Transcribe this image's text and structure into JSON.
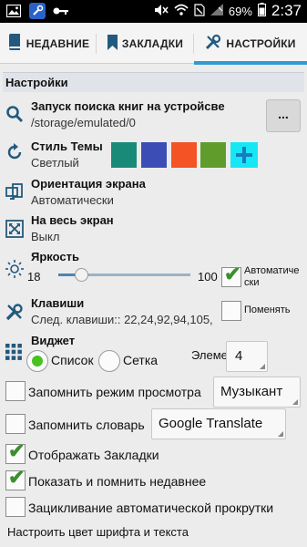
{
  "statusbar": {
    "icons_left": [
      "image-icon",
      "wrench-app-icon",
      "key-icon"
    ],
    "battery_percent": "69%",
    "time": "2:37"
  },
  "tabs": [
    {
      "label": "НЕДАВНИЕ",
      "icon": "book-icon",
      "active": false
    },
    {
      "label": "ЗАКЛАДКИ",
      "icon": "bookmark-icon",
      "active": false
    },
    {
      "label": "НАСТРОЙКИ",
      "icon": "tools-icon",
      "active": true
    }
  ],
  "settings": {
    "header": "Настройки",
    "search": {
      "title": "Запуск поиска книг на устройсве",
      "path": "/storage/emulated/0",
      "button": "..."
    },
    "theme": {
      "title": "Стиль Темы",
      "value": "Светлый",
      "colors": [
        "#1a8a78",
        "#3c4db5",
        "#f45326",
        "#5f9c2c"
      ],
      "add_label": "+",
      "add_color": "#16e7f4"
    },
    "orientation": {
      "title": "Ориентация экрана",
      "value": "Автоматически"
    },
    "fullscreen": {
      "title": "На весь экран",
      "value": "Выкл"
    },
    "brightness": {
      "title": "Яркость",
      "min": "18",
      "max": "100",
      "level_fraction": 0.17,
      "auto_label": "Автоматически",
      "auto_checked": true
    },
    "keys": {
      "title": "Клавиши",
      "value": "След. клавиши:: 22,24,92,94,105,",
      "swap_label": "Поменять",
      "swap_checked": false
    },
    "widget": {
      "title": "Виджет",
      "option_list": "Список",
      "option_grid": "Сетка",
      "selected": "Список",
      "elements_label": "Элементов",
      "elements_value": "4"
    },
    "remember_view": {
      "label": "Запомнить режим просмотра",
      "checked": false,
      "dropdown_value": "Музыкант"
    },
    "remember_dict": {
      "label": "Запомнить словарь",
      "checked": false,
      "dropdown_value": "Google Translate"
    },
    "show_bookmarks": {
      "label": "Отображать Закладки",
      "checked": true
    },
    "show_recent": {
      "label": "Показать и помнить недавнее",
      "checked": true
    },
    "autoscroll_loop": {
      "label": "Зацикливание автоматической прокрутки",
      "checked": false
    },
    "font_color": {
      "label": "Настроить цвет шрифта и текста"
    }
  }
}
